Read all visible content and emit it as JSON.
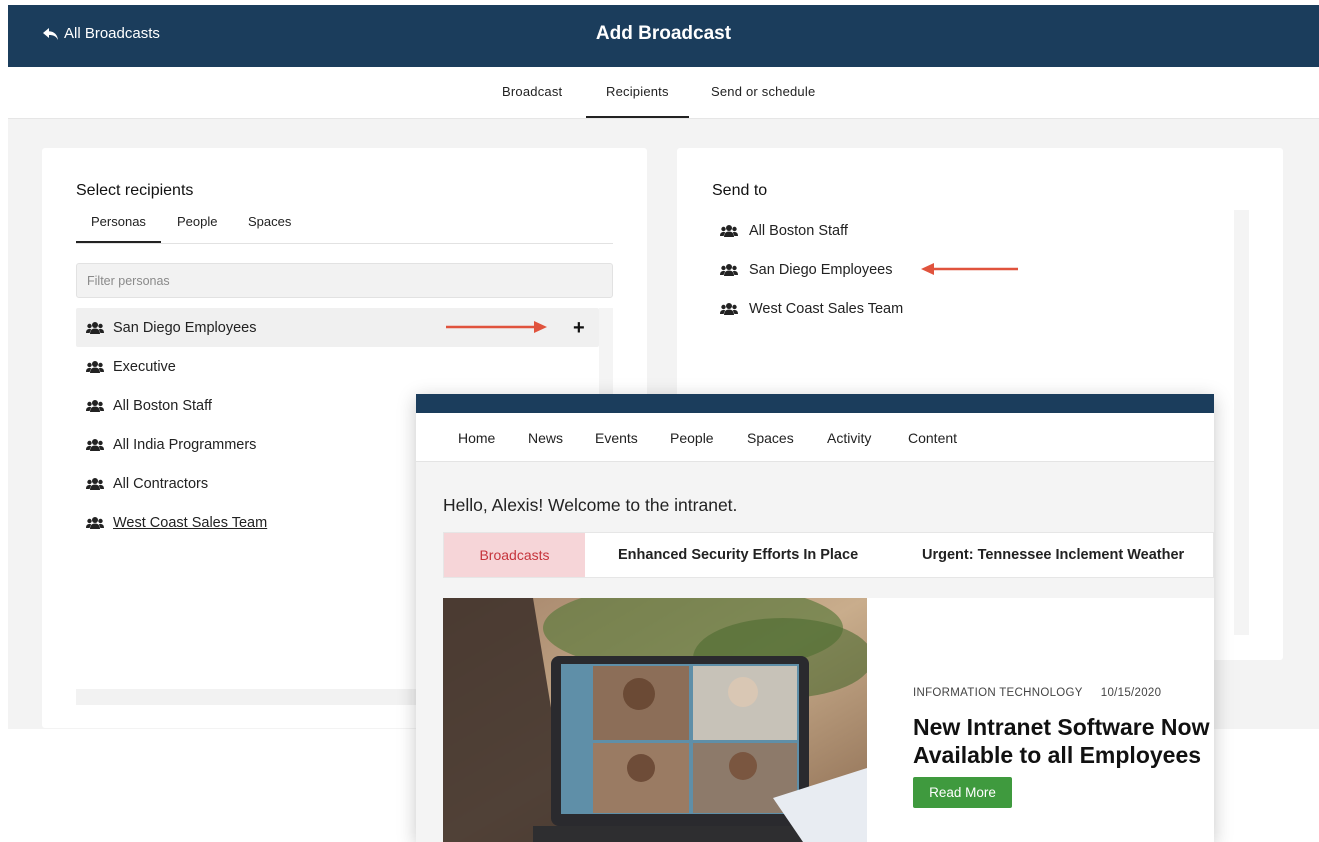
{
  "header": {
    "back_label": "All Broadcasts",
    "title": "Add Broadcast"
  },
  "tabs": [
    {
      "label": "Broadcast"
    },
    {
      "label": "Recipients",
      "active": true
    },
    {
      "label": "Send or schedule"
    }
  ],
  "select_recipients": {
    "heading": "Select recipients",
    "subtabs": [
      {
        "label": "Personas",
        "active": true
      },
      {
        "label": "People"
      },
      {
        "label": "Spaces"
      }
    ],
    "filter_placeholder": "Filter personas",
    "personas": [
      {
        "label": "San Diego Employees",
        "highlighted": true
      },
      {
        "label": "Executive"
      },
      {
        "label": "All Boston Staff"
      },
      {
        "label": "All India Programmers"
      },
      {
        "label": "All Contractors"
      },
      {
        "label": "West Coast Sales Team",
        "underlined": true
      }
    ],
    "add_icon": "plus-icon"
  },
  "send_to": {
    "heading": "Send to",
    "recipients": [
      {
        "label": "All Boston Staff"
      },
      {
        "label": "San Diego Employees"
      },
      {
        "label": "West Coast Sales Team"
      }
    ]
  },
  "preview": {
    "nav": [
      "Home",
      "News",
      "Events",
      "People",
      "Spaces",
      "Activity",
      "Content"
    ],
    "welcome": "Hello, Alexis! Welcome to the intranet.",
    "ticker": {
      "label": "Broadcasts",
      "items": [
        "Enhanced Security Efforts In Place",
        "Urgent: Tennessee Inclement Weather"
      ]
    },
    "article": {
      "category": "INFORMATION TECHNOLOGY",
      "date": "10/15/2020",
      "title_line1": "New Intranet Software Now",
      "title_line2": "Available to all Employees",
      "button": "Read More"
    }
  },
  "colors": {
    "navy": "#1b3d5c",
    "annotation_arrow": "#e0533d",
    "ticker_bg": "#f6d5d8",
    "ticker_text": "#c6343c",
    "button_green": "#3f9a3e"
  }
}
